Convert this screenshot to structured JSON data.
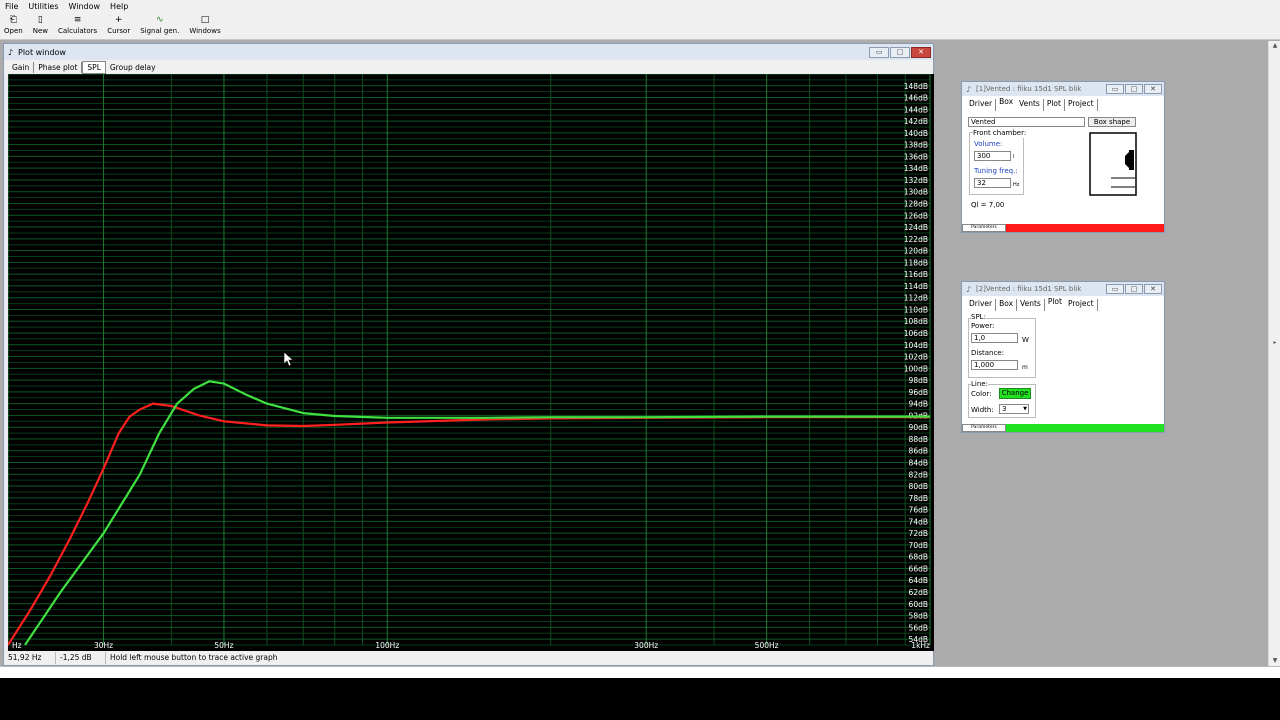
{
  "menu": [
    "File",
    "Utilities",
    "Window",
    "Help"
  ],
  "toolbar": [
    {
      "label": "Open",
      "icon": "open-folder-icon",
      "glyph": "⎗"
    },
    {
      "label": "New",
      "icon": "new-document-icon",
      "glyph": "▯"
    },
    {
      "label": "Calculators",
      "icon": "calculator-icon",
      "glyph": "≡"
    },
    {
      "label": "Cursor",
      "icon": "crosshair-icon",
      "glyph": "+"
    },
    {
      "label": "Signal gen.",
      "icon": "signal-generator-icon",
      "glyph": "∿"
    },
    {
      "label": "Windows",
      "icon": "windows-icon",
      "glyph": "□"
    }
  ],
  "plot_window": {
    "title": "Plot window",
    "tabs": [
      "Gain",
      "Phase plot",
      "SPL",
      "Group delay"
    ],
    "active_tab": "SPL",
    "status": {
      "freq": "51,92 Hz",
      "db": "-1,25 dB",
      "hint": "Hold left mouse button to trace active graph"
    }
  },
  "chart_data": {
    "type": "line",
    "x_scale": "log",
    "xlim": [
      20,
      1000
    ],
    "ylim": [
      53,
      150
    ],
    "x_tick_labels": [
      "Hz",
      "30Hz",
      "50Hz",
      "100Hz",
      "300Hz",
      "500Hz",
      "1kHz"
    ],
    "y_tick_labels": [
      "148dB",
      "146dB",
      "144dB",
      "142dB",
      "140dB",
      "138dB",
      "136dB",
      "134dB",
      "132dB",
      "130dB",
      "128dB",
      "126dB",
      "124dB",
      "122dB",
      "120dB",
      "118dB",
      "116dB",
      "114dB",
      "112dB",
      "110dB",
      "108dB",
      "106dB",
      "104dB",
      "102dB",
      "100dB",
      "98dB",
      "96dB",
      "94dB",
      "92dB",
      "90dB",
      "88dB",
      "86dB",
      "84dB",
      "82dB",
      "80dB",
      "78dB",
      "76dB",
      "74dB",
      "72dB",
      "70dB",
      "68dB",
      "66dB",
      "64dB",
      "62dB",
      "60dB",
      "58dB",
      "56dB",
      "54dB"
    ],
    "grid": true,
    "series": [
      {
        "color": "#ff2020",
        "x": [
          20,
          22,
          24,
          26,
          28,
          30,
          32,
          33.5,
          35,
          37,
          40,
          45,
          50,
          60,
          70,
          80,
          100,
          150,
          200,
          300,
          500,
          1000
        ],
        "y": [
          53,
          59,
          65,
          71,
          77,
          83,
          89,
          91.8,
          93,
          94,
          93.6,
          92,
          91,
          90.3,
          90.2,
          90.4,
          90.8,
          91.3,
          91.5,
          91.6,
          91.7,
          91.7
        ]
      },
      {
        "color": "#40e040",
        "x": [
          21.5,
          25,
          30,
          35,
          38,
          41,
          44,
          47,
          50,
          55,
          60,
          70,
          80,
          100,
          150,
          200,
          300,
          500,
          1000
        ],
        "y": [
          53,
          62,
          72,
          82,
          89,
          94,
          96.5,
          97.8,
          97.4,
          95.5,
          94,
          92.4,
          91.9,
          91.6,
          91.6,
          91.7,
          91.7,
          91.8,
          91.8
        ]
      }
    ]
  },
  "window1": {
    "title": "[1]Vented : fiiku 15d1 SPL blik",
    "tabs": [
      "Driver",
      "Box",
      "Vents",
      "Plot",
      "Project"
    ],
    "active_tab": "Box",
    "box_type": "Vented",
    "box_shape_button": "Box shape",
    "front_chamber_label": "Front chamber:",
    "volume_label": "Volume:",
    "volume_value": "300",
    "volume_unit": "l",
    "tuning_label": "Tuning freq.:",
    "tuning_value": "32",
    "tuning_unit": "Hz",
    "ql": "Ql = 7,00",
    "parameters": "Parameters",
    "color": "#ff1a1a"
  },
  "window2": {
    "title": "[2]Vented : fiiku 15d1 SPL blik",
    "tabs": [
      "Driver",
      "Box",
      "Vents",
      "Plot",
      "Project"
    ],
    "active_tab": "Plot",
    "spl_label": "SPL:",
    "power_label": "Power:",
    "power_value": "1,0",
    "power_unit": "W",
    "distance_label": "Distance:",
    "distance_value": "1,000",
    "distance_unit": "m",
    "line_label": "Line:",
    "color_label": "Color:",
    "change_button": "Change",
    "width_label": "Width:",
    "width_value": "3",
    "parameters": "Parameters",
    "color": "#22e022"
  }
}
